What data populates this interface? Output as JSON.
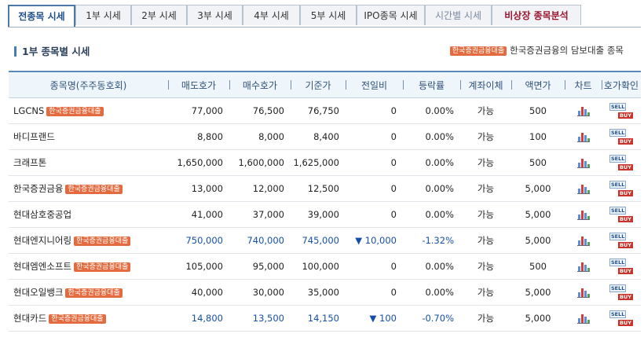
{
  "tabs": [
    {
      "label": "전종목 시세",
      "state": "active"
    },
    {
      "label": "1부 시세",
      "state": "normal"
    },
    {
      "label": "2부 시세",
      "state": "normal"
    },
    {
      "label": "3부 시세",
      "state": "normal"
    },
    {
      "label": "4부 시세",
      "state": "normal"
    },
    {
      "label": "5부 시세",
      "state": "normal"
    },
    {
      "label": "IPO종목 시세",
      "state": "normal"
    },
    {
      "label": "시간별 시세",
      "state": "muted"
    },
    {
      "label": "비상장 종목분석",
      "state": "special"
    }
  ],
  "section": {
    "title": "1부 종목별 시세"
  },
  "badge_text": "한국증권금융대출",
  "legend": {
    "text": "한국증권금융의 담보대출 종목"
  },
  "columns": [
    "종목명(주주동호회)",
    "매도호가",
    "매수호가",
    "기준가",
    "전일비",
    "등락률",
    "계좌이체",
    "액면가",
    "차트",
    "호가확인"
  ],
  "rows": [
    {
      "name": "LGCNS",
      "badge": true,
      "sell": "77,000",
      "buy": "76,500",
      "base": "76,750",
      "change": "0",
      "change_dir": "none",
      "rate": "0.00%",
      "transfer": "가능",
      "par": "500",
      "highlight": false
    },
    {
      "name": "바디프랜드",
      "badge": false,
      "sell": "8,800",
      "buy": "8,000",
      "base": "8,400",
      "change": "0",
      "change_dir": "none",
      "rate": "0.00%",
      "transfer": "가능",
      "par": "100",
      "highlight": false
    },
    {
      "name": "크래프톤",
      "badge": false,
      "sell": "1,650,000",
      "buy": "1,600,000",
      "base": "1,625,000",
      "change": "0",
      "change_dir": "none",
      "rate": "0.00%",
      "transfer": "가능",
      "par": "500",
      "highlight": false
    },
    {
      "name": "한국증권금융",
      "badge": true,
      "sell": "13,000",
      "buy": "12,000",
      "base": "12,500",
      "change": "0",
      "change_dir": "none",
      "rate": "0.00%",
      "transfer": "가능",
      "par": "5,000",
      "highlight": false
    },
    {
      "name": "현대삼호중공업",
      "badge": false,
      "sell": "41,000",
      "buy": "37,000",
      "base": "39,000",
      "change": "0",
      "change_dir": "none",
      "rate": "0.00%",
      "transfer": "가능",
      "par": "5,000",
      "highlight": false
    },
    {
      "name": "현대엔지니어링",
      "badge": true,
      "sell": "750,000",
      "buy": "740,000",
      "base": "745,000",
      "change": "10,000",
      "change_dir": "down",
      "rate": "-1.32%",
      "transfer": "가능",
      "par": "5,000",
      "highlight": true
    },
    {
      "name": "현대엠엔소프트",
      "badge": true,
      "sell": "105,000",
      "buy": "95,000",
      "base": "100,000",
      "change": "0",
      "change_dir": "none",
      "rate": "0.00%",
      "transfer": "가능",
      "par": "500",
      "highlight": false
    },
    {
      "name": "현대오일뱅크",
      "badge": true,
      "sell": "40,000",
      "buy": "30,000",
      "base": "35,000",
      "change": "0",
      "change_dir": "none",
      "rate": "0.00%",
      "transfer": "가능",
      "par": "5,000",
      "highlight": false
    },
    {
      "name": "현대카드",
      "badge": true,
      "sell": "14,800",
      "buy": "13,500",
      "base": "14,150",
      "change": "100",
      "change_dir": "down",
      "rate": "-0.70%",
      "transfer": "가능",
      "par": "5,000",
      "highlight": true
    }
  ],
  "icons": {
    "chart": "bar-chart-icon",
    "hoga": "sell-buy-icon",
    "down_arrow": "▼"
  },
  "hoga_icon": {
    "sell": "SELL",
    "buy": "BUY"
  },
  "colors": {
    "accent": "#4e78a8",
    "badge": "#e36b3f",
    "down": "#1550a8",
    "special_tab": "#9b1530"
  }
}
